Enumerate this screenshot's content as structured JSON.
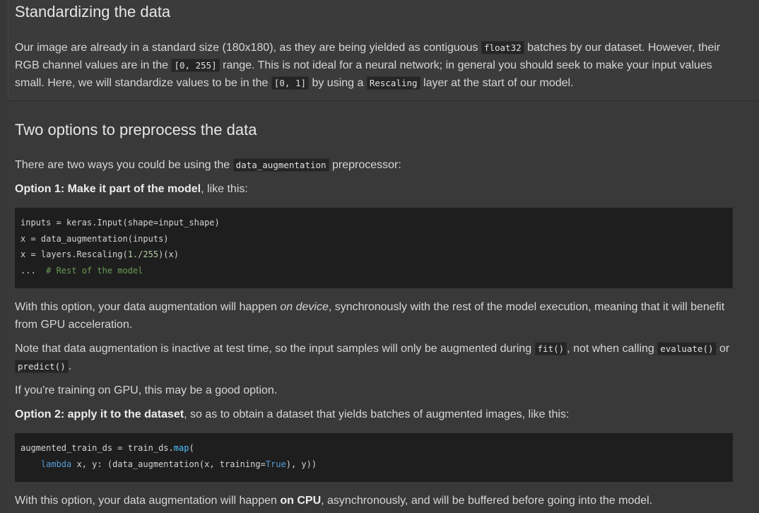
{
  "section1": {
    "heading": "Standardizing the data",
    "para": {
      "t1": "Our image are already in a standard size (180x180), as they are being yielded as contiguous ",
      "c1": "float32",
      "t2": " batches by our dataset. However, their RGB channel values are in the ",
      "c2": "[0, 255]",
      "t3": " range. This is not ideal for a neural network; in general you should seek to make your input values small. Here, we will standardize values to be in the ",
      "c3": "[0, 1]",
      "t4": " by using a ",
      "c4": "Rescaling",
      "t5": " layer at the start of our model."
    }
  },
  "section2": {
    "heading": "Two options to preprocess the data",
    "intro": {
      "t1": "There are two ways you could be using the ",
      "c1": "data_augmentation",
      "t2": " preprocessor:"
    },
    "option1": {
      "bold": "Option 1: Make it part of the model",
      "rest": ", like this:"
    },
    "code1": {
      "l1": "inputs = keras.Input(shape=input_shape)",
      "l2": "x = data_augmentation(inputs)",
      "l3a": "x = layers.Rescaling(",
      "l3num": "1./255",
      "l3b": ")(x)",
      "l4a": "...  ",
      "l4com": "# Rest of the model"
    },
    "para1": {
      "t1": "With this option, your data augmentation will happen ",
      "em": "on device",
      "t2": ", synchronously with the rest of the model execution, meaning that it will benefit from GPU acceleration."
    },
    "para2": {
      "t1": "Note that data augmentation is inactive at test time, so the input samples will only be augmented during ",
      "c1": "fit()",
      "t2": ", not when calling ",
      "c2": "evaluate()",
      "t3": " or ",
      "c3": "predict()",
      "t4": "."
    },
    "para3": "If you're training on GPU, this may be a good option.",
    "option2": {
      "bold": "Option 2: apply it to the dataset",
      "rest": ", so as to obtain a dataset that yields batches of augmented images, like this:"
    },
    "code2": {
      "l1a": "augmented_train_ds = train_ds.",
      "l1fn": "map",
      "l1b": "(",
      "l2indent": "    ",
      "l2kw": "lambda",
      "l2a": " x, y: (data_augmentation(x, training=",
      "l2kw2": "True",
      "l2b": "), y))"
    },
    "para4": {
      "t1": "With this option, your data augmentation will happen ",
      "bold": "on CPU",
      "t2": ", asynchronously, and will be buffered before going into the model."
    }
  }
}
